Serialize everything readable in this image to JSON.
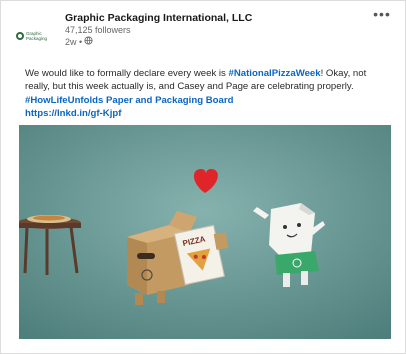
{
  "post": {
    "company_name": "Graphic Packaging International, LLC",
    "followers": "47,125 followers",
    "age": "2w •",
    "logo_text_line1": "Graphic",
    "logo_text_line2": "Packaging",
    "more_label": "•••",
    "body_line1_prefix": "We would like to formally declare every week is ",
    "hashtag_pizza": "#NationalPizzaWeek",
    "body_line1_suffix": "! Okay, not really, but this week actually is, and Casey and Page are celebrating properly.",
    "hashtag_board": "#HowLifeUnfolds Paper and Packaging Board",
    "link": "https://lnkd.in/gf-Kjpf"
  },
  "image": {
    "pizza_box_text": "PIZZA",
    "bg_color": "#6b9a97",
    "heart_color": "#e0252a"
  },
  "icons": {
    "globe": "globe-icon",
    "more": "more-options-icon",
    "logo": "company-logo"
  }
}
